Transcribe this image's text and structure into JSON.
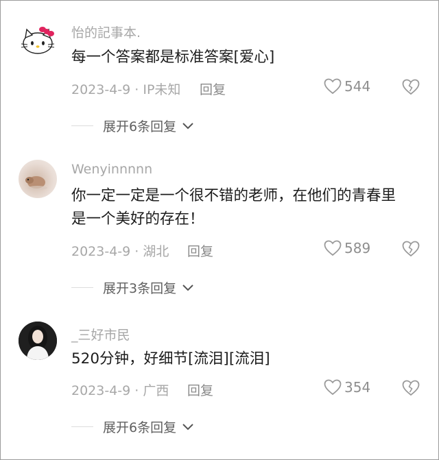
{
  "comments": [
    {
      "username": "怡的記事本.",
      "text": "每一个答案都是标准答案[爱心]",
      "meta": "2023-4-9 · IP未知",
      "reply_label": "回复",
      "likes": "544",
      "expand_label": "展开6条回复"
    },
    {
      "username": "Wenyinnnnn",
      "text": "你一定一定是一个很不错的老师，在他们的青春里是一个美好的存在！",
      "meta": "2023-4-9 · 湖北",
      "reply_label": "回复",
      "likes": "589",
      "expand_label": "展开3条回复"
    },
    {
      "username": "_三好市民",
      "text": "520分钟，好细节[流泪][流泪]",
      "meta": "2023-4-9 · 广西",
      "reply_label": "回复",
      "likes": "354",
      "expand_label": "展开6条回复"
    }
  ],
  "colors": {
    "text": "#1c1c1c",
    "muted": "#a7a7a7",
    "icon": "#9a9a9a"
  },
  "icons": {
    "like": "heart-outline-icon",
    "dislike": "broken-heart-icon",
    "expand": "chevron-down-icon"
  }
}
